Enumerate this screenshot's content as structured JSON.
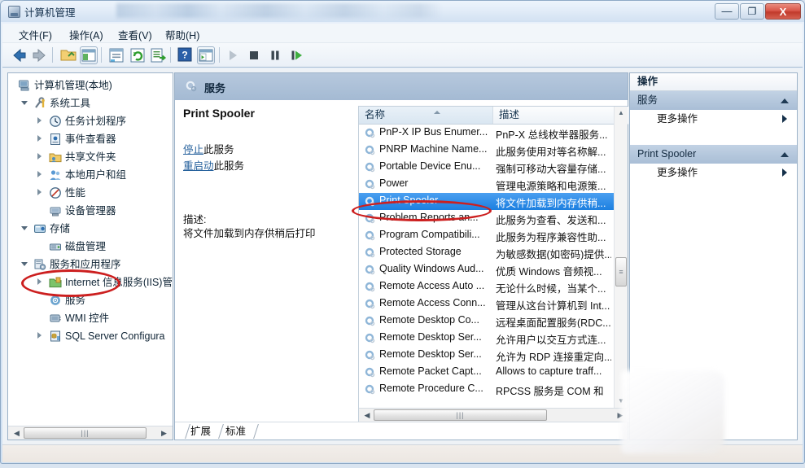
{
  "window": {
    "title": "计算机管理",
    "icon": "computer-management-icon",
    "controls": {
      "minimize": "—",
      "maximize": "❐",
      "close": "X"
    }
  },
  "menu": [
    {
      "label": "文件(F)",
      "accel": "F"
    },
    {
      "label": "操作(A)",
      "accel": "A"
    },
    {
      "label": "查看(V)",
      "accel": "V"
    },
    {
      "label": "帮助(H)",
      "accel": "H"
    }
  ],
  "toolbar": {
    "buttons": [
      {
        "name": "back-icon"
      },
      {
        "name": "forward-icon"
      },
      {
        "name": "up-folder-icon"
      },
      {
        "name": "show-hide-console-tree-icon"
      },
      {
        "name": "properties-icon"
      },
      {
        "name": "refresh-icon"
      },
      {
        "name": "export-list-icon"
      },
      {
        "name": "help-icon"
      },
      {
        "name": "show-action-pane-icon"
      },
      {
        "name": "start-service-icon"
      },
      {
        "name": "stop-service-icon"
      },
      {
        "name": "pause-service-icon"
      },
      {
        "name": "restart-service-icon"
      }
    ]
  },
  "tree": {
    "nodes": [
      {
        "label": "计算机管理(本地)",
        "depth": 0,
        "state": "none",
        "icon": "computer-icon"
      },
      {
        "label": "系统工具",
        "depth": 1,
        "state": "expanded",
        "icon": "system-tools-icon"
      },
      {
        "label": "任务计划程序",
        "depth": 2,
        "state": "collapsed",
        "icon": "task-scheduler-icon"
      },
      {
        "label": "事件查看器",
        "depth": 2,
        "state": "collapsed",
        "icon": "event-viewer-icon"
      },
      {
        "label": "共享文件夹",
        "depth": 2,
        "state": "collapsed",
        "icon": "shared-folders-icon"
      },
      {
        "label": "本地用户和组",
        "depth": 2,
        "state": "collapsed",
        "icon": "local-users-groups-icon"
      },
      {
        "label": "性能",
        "depth": 2,
        "state": "collapsed",
        "icon": "performance-icon"
      },
      {
        "label": "设备管理器",
        "depth": 2,
        "state": "none",
        "icon": "device-manager-icon"
      },
      {
        "label": "存储",
        "depth": 1,
        "state": "expanded",
        "icon": "storage-icon"
      },
      {
        "label": "磁盘管理",
        "depth": 2,
        "state": "none",
        "icon": "disk-management-icon"
      },
      {
        "label": "服务和应用程序",
        "depth": 1,
        "state": "expanded",
        "icon": "services-applications-icon"
      },
      {
        "label": "Internet 信息服务(IIS)管",
        "depth": 2,
        "state": "collapsed",
        "icon": "iis-icon"
      },
      {
        "label": "服务",
        "depth": 2,
        "state": "none",
        "icon": "services-icon"
      },
      {
        "label": "WMI 控件",
        "depth": 2,
        "state": "none",
        "icon": "wmi-control-icon"
      },
      {
        "label": "SQL Server Configura",
        "depth": 2,
        "state": "collapsed",
        "icon": "sql-server-icon"
      }
    ],
    "hscrollbar": {
      "left_arrow": "◀",
      "right_arrow": "▶",
      "grip": "|||"
    }
  },
  "center": {
    "header": {
      "title": "服务",
      "icon": "services-gear-icon"
    },
    "detail": {
      "service_name": "Print Spooler",
      "stop_link": "停止",
      "stop_suffix": "此服务",
      "restart_link": "重启动",
      "restart_suffix": "此服务",
      "description_label": "描述:",
      "description_text": "将文件加载到内存供稍后打印"
    },
    "columns": [
      {
        "key": "name",
        "label": "名称",
        "sorted": true
      },
      {
        "key": "desc",
        "label": "描述",
        "sorted": false
      }
    ],
    "rows": [
      {
        "name": "PnP-X IP Bus Enumer...",
        "desc": "PnP-X 总线枚举器服务...",
        "selected": false
      },
      {
        "name": "PNRP Machine Name...",
        "desc": "此服务使用对等名称解...",
        "selected": false
      },
      {
        "name": "Portable Device Enu...",
        "desc": "强制可移动大容量存储...",
        "selected": false
      },
      {
        "name": "Power",
        "desc": "管理电源策略和电源策...",
        "selected": false
      },
      {
        "name": "Print Spooler",
        "desc": "将文件加载到内存供稍...",
        "selected": true
      },
      {
        "name": "Problem Reports an...",
        "desc": "此服务为查看、发送和...",
        "selected": false
      },
      {
        "name": "Program Compatibili...",
        "desc": "此服务为程序兼容性助...",
        "selected": false
      },
      {
        "name": "Protected Storage",
        "desc": "为敏感数据(如密码)提供...",
        "selected": false
      },
      {
        "name": "Quality Windows Aud...",
        "desc": "优质 Windows 音频视...",
        "selected": false
      },
      {
        "name": "Remote Access Auto ...",
        "desc": "无论什么时候，当某个...",
        "selected": false
      },
      {
        "name": "Remote Access Conn...",
        "desc": "管理从这台计算机到 Int...",
        "selected": false
      },
      {
        "name": "Remote Desktop Co...",
        "desc": "远程桌面配置服务(RDC...",
        "selected": false
      },
      {
        "name": "Remote Desktop Ser...",
        "desc": "允许用户以交互方式连...",
        "selected": false
      },
      {
        "name": "Remote Desktop Ser...",
        "desc": "允许为 RDP 连接重定向...",
        "selected": false
      },
      {
        "name": "Remote Packet Capt...",
        "desc": "Allows to capture traff...",
        "selected": false
      },
      {
        "name": "Remote Procedure C...",
        "desc": "RPCSS 服务是 COM 和",
        "selected": false
      }
    ],
    "vscrollbar": {
      "up_arrow": "▲",
      "down_arrow": "▼",
      "grip": "≡"
    },
    "hscrollbar": {
      "left_arrow": "◀",
      "right_arrow": "▶",
      "grip": "|||"
    },
    "tabs": [
      {
        "label": "扩展",
        "active": false
      },
      {
        "label": "标准",
        "active": true
      }
    ]
  },
  "actions": {
    "title": "操作",
    "groups": [
      {
        "title": "服务",
        "items": [
          {
            "label": "更多操作"
          }
        ]
      },
      {
        "title": "Print Spooler",
        "items": [
          {
            "label": "更多操作"
          }
        ]
      }
    ]
  },
  "annotations": [
    {
      "name": "tree-services-highlight",
      "shape": "ellipse",
      "color": "#cc1f1f"
    },
    {
      "name": "list-print-spooler-highlight",
      "shape": "ellipse",
      "color": "#cc1f1f"
    }
  ],
  "colors": {
    "accent": "#cc1f1f",
    "selection": "#1c7fe0",
    "header_blue": "#a4bad3",
    "link": "#26619c"
  }
}
